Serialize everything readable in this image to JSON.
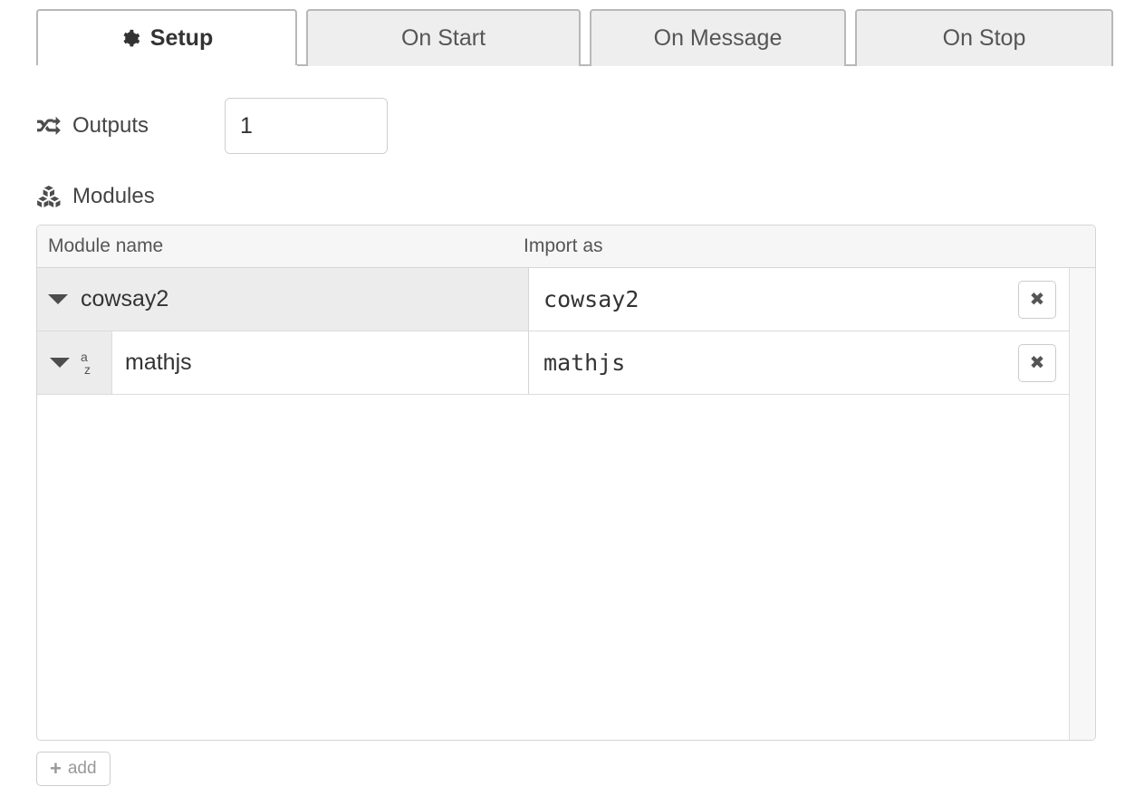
{
  "tabs": [
    {
      "label": "Setup",
      "icon": "gear-icon",
      "active": true
    },
    {
      "label": "On Start",
      "icon": null,
      "active": false
    },
    {
      "label": "On Message",
      "icon": null,
      "active": false
    },
    {
      "label": "On Stop",
      "icon": null,
      "active": false
    }
  ],
  "outputs": {
    "label": "Outputs",
    "icon": "random-shuffle-icon",
    "value": "1",
    "increment_icon": "triangle-up-icon",
    "decrement_icon": "triangle-down-icon"
  },
  "modules": {
    "label": "Modules",
    "icon": "cubes-icon",
    "columns": {
      "name": "Module name",
      "import_as": "Import as"
    },
    "rows": [
      {
        "name": "cowsay2",
        "import_as": "cowsay2",
        "dragging": true,
        "caret_icon": "caret-down-icon",
        "sort_icon": null,
        "delete_label": "✖"
      },
      {
        "name": "mathjs",
        "import_as": "mathjs",
        "dragging": false,
        "caret_icon": "caret-down-icon",
        "sort_icon": "sort-alpha-icon",
        "delete_label": "✖"
      }
    ]
  },
  "add_button": {
    "label": "add",
    "plus": "+"
  },
  "colors": {
    "tab_inactive_bg": "#eeeeee",
    "tab_border": "#b8b8b8",
    "active_tab_bg": "#ffffff",
    "header_bg": "#f6f6f6",
    "row_drag_bg": "#ececec",
    "handle_bg": "#ececec",
    "text": "#333333",
    "muted_text": "#555555",
    "border": "#d4d4d4",
    "add_text": "#999999"
  }
}
